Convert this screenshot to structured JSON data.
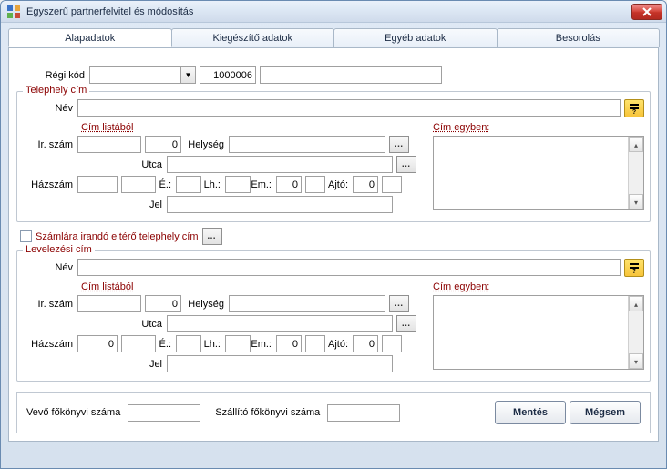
{
  "window": {
    "title": "Egyszerű partnerfelvitel és módosítás"
  },
  "tabs": {
    "alapadatok": "Alapadatok",
    "kiegeszito": "Kiegészítő adatok",
    "egyeb": "Egyéb adatok",
    "besorolas": "Besorolás"
  },
  "main": {
    "regi_kod_label": "Régi kód",
    "regi_kod_value": "",
    "code_value": "1000006",
    "extra_value": ""
  },
  "groups": {
    "telephely_legend": "Telephely cím",
    "levelezesi_legend": "Levelezési cím",
    "nev_label": "Név",
    "cim_listabol": "Cím listából",
    "cim_egyben": "Cím egyben:",
    "ir_szam": "Ir. szám",
    "helyseg": "Helység",
    "utca": "Utca",
    "hazszam": "Házszám",
    "ep": "É.:",
    "lh": "Lh.:",
    "em": "Em.:",
    "ajto": "Ajtó:",
    "jel": "Jel",
    "zero": "0",
    "eltero_label": "Számlára irandó eltérő telephely cím"
  },
  "t": {
    "nev": "",
    "irszam": "",
    "irszam2": "0",
    "helyseg": "",
    "utca": "",
    "hazszam": "",
    "ep": "",
    "lh": "",
    "em": "0",
    "em2": "",
    "ajto": "0",
    "ajto2": "",
    "jel": "",
    "egyben": ""
  },
  "l": {
    "nev": "",
    "irszam": "",
    "irszam2": "0",
    "helyseg": "",
    "utca": "",
    "hazszam": "0",
    "ep": "",
    "lh": "",
    "em": "0",
    "em2": "",
    "ajto": "0",
    "ajto2": "",
    "jel": "",
    "egyben": ""
  },
  "bottom": {
    "vevo_label": "Vevő főkönyvi száma",
    "vevo_value": "",
    "szallito_label": "Szállító főkönyvi száma",
    "szallito_value": "",
    "save": "Mentés",
    "cancel": "Mégsem"
  }
}
